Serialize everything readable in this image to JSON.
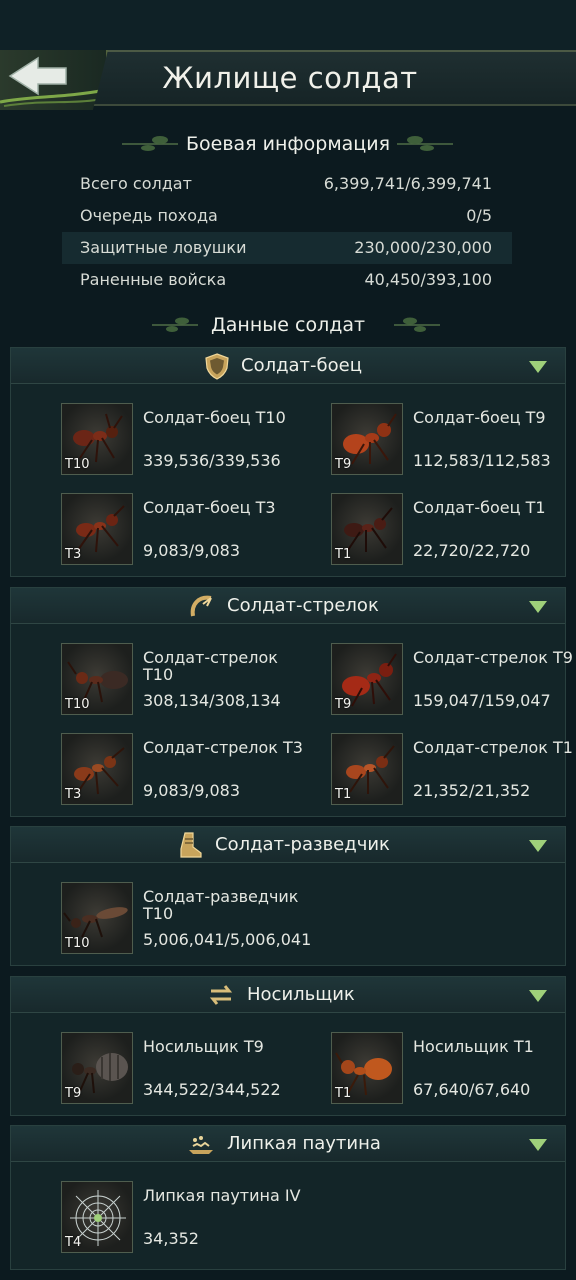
{
  "header": {
    "title": "Жилище солдат"
  },
  "battle_info": {
    "title": "Боевая информация",
    "rows": [
      {
        "label": "Всего солдат",
        "value": "6,399,741/6,399,741"
      },
      {
        "label": "Очередь похода",
        "value": "0/5"
      },
      {
        "label": "Защитные ловушки",
        "value": "230,000/230,000"
      },
      {
        "label": "Раненные войска",
        "value": "40,450/393,100"
      }
    ]
  },
  "soldier_data": {
    "title": "Данные солдат"
  },
  "categories": [
    {
      "label": "Солдат-боец",
      "icon": "shield-icon",
      "units": [
        {
          "name": "Солдат-боец Т10",
          "count": "339,536/339,536",
          "tier": "T10"
        },
        {
          "name": "Солдат-боец Т9",
          "count": "112,583/112,583",
          "tier": "T9"
        },
        {
          "name": "Солдат-боец Т3",
          "count": "9,083/9,083",
          "tier": "T3"
        },
        {
          "name": "Солдат-боец Т1",
          "count": "22,720/22,720",
          "tier": "T1"
        }
      ]
    },
    {
      "label": "Солдат-стрелок",
      "icon": "bow-icon",
      "units": [
        {
          "name": "Солдат-стрелок Т10",
          "count": "308,134/308,134",
          "tier": "T10"
        },
        {
          "name": "Солдат-стрелок Т9",
          "count": "159,047/159,047",
          "tier": "T9"
        },
        {
          "name": "Солдат-стрелок Т3",
          "count": "9,083/9,083",
          "tier": "T3"
        },
        {
          "name": "Солдат-стрелок Т1",
          "count": "21,352/21,352",
          "tier": "T1"
        }
      ]
    },
    {
      "label": "Солдат-разведчик",
      "icon": "boot-icon",
      "units": [
        {
          "name": "Солдат-разведчик Т10",
          "count": "5,006,041/5,006,041",
          "tier": "T10"
        }
      ]
    },
    {
      "label": "Носильщик",
      "icon": "transfer-arrows-icon",
      "units": [
        {
          "name": "Носильщик Т9",
          "count": "344,522/344,522",
          "tier": "T9"
        },
        {
          "name": "Носильщик Т1",
          "count": "67,640/67,640",
          "tier": "T1"
        }
      ]
    },
    {
      "label": "Липкая паутина",
      "icon": "web-trap-icon",
      "units": [
        {
          "name": "Липкая паутина IV",
          "count": "34,352",
          "tier": "T4"
        }
      ]
    }
  ],
  "colors": {
    "accent": "#9fd07a",
    "background": "#0c1a1f",
    "panel": "#132528"
  }
}
